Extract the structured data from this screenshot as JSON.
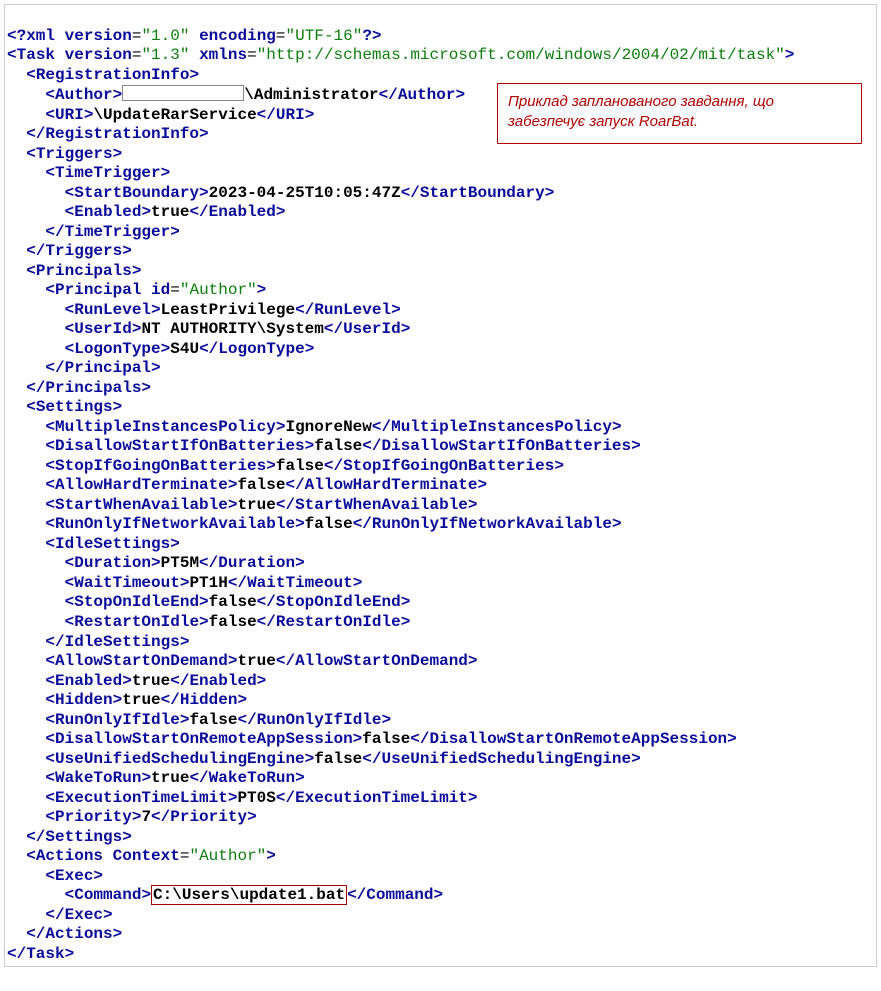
{
  "annotation": {
    "line1": "Приклад запланованого завдання, що",
    "line2": "забезпечує запуск RoarBat."
  },
  "xml": {
    "decl_version_attr": "version",
    "decl_version_val": "\"1.0\"",
    "decl_encoding_attr": "encoding",
    "decl_encoding_val": "\"UTF-16\"",
    "task": "Task",
    "task_version_attr": "version",
    "task_version_val": "\"1.3\"",
    "task_xmlns_attr": "xmlns",
    "task_xmlns_val": "\"http://schemas.microsoft.com/windows/2004/02/mit/task\"",
    "RegistrationInfo": "RegistrationInfo",
    "Author": "Author",
    "Author_val_suffix": "\\Administrator",
    "URI": "URI",
    "URI_val": "\\UpdateRarService",
    "Triggers": "Triggers",
    "TimeTrigger": "TimeTrigger",
    "StartBoundary": "StartBoundary",
    "StartBoundary_val": "2023-04-25T10:05:47Z",
    "Enabled": "Enabled",
    "Enabled_val_true": "true",
    "Principals": "Principals",
    "Principal": "Principal",
    "Principal_id_attr": "id",
    "Principal_id_val": "\"Author\"",
    "RunLevel": "RunLevel",
    "RunLevel_val": "LeastPrivilege",
    "UserId": "UserId",
    "UserId_val": "NT AUTHORITY\\System",
    "LogonType": "LogonType",
    "LogonType_val": "S4U",
    "Settings": "Settings",
    "MultipleInstancesPolicy": "MultipleInstancesPolicy",
    "MultipleInstancesPolicy_val": "IgnoreNew",
    "DisallowStartIfOnBatteries": "DisallowStartIfOnBatteries",
    "false_val": "false",
    "true_val": "true",
    "StopIfGoingOnBatteries": "StopIfGoingOnBatteries",
    "AllowHardTerminate": "AllowHardTerminate",
    "StartWhenAvailable": "StartWhenAvailable",
    "RunOnlyIfNetworkAvailable": "RunOnlyIfNetworkAvailable",
    "IdleSettings": "IdleSettings",
    "Duration": "Duration",
    "Duration_val": "PT5M",
    "WaitTimeout": "WaitTimeout",
    "WaitTimeout_val": "PT1H",
    "StopOnIdleEnd": "StopOnIdleEnd",
    "RestartOnIdle": "RestartOnIdle",
    "AllowStartOnDemand": "AllowStartOnDemand",
    "Hidden": "Hidden",
    "RunOnlyIfIdle": "RunOnlyIfIdle",
    "DisallowStartOnRemoteAppSession": "DisallowStartOnRemoteAppSession",
    "UseUnifiedSchedulingEngine": "UseUnifiedSchedulingEngine",
    "WakeToRun": "WakeToRun",
    "ExecutionTimeLimit": "ExecutionTimeLimit",
    "ExecutionTimeLimit_val": "PT0S",
    "Priority": "Priority",
    "Priority_val": "7",
    "Actions": "Actions",
    "Actions_context_attr": "Context",
    "Actions_context_val": "\"Author\"",
    "Exec": "Exec",
    "Command": "Command",
    "Command_val": "C:\\Users\\update1.bat"
  }
}
